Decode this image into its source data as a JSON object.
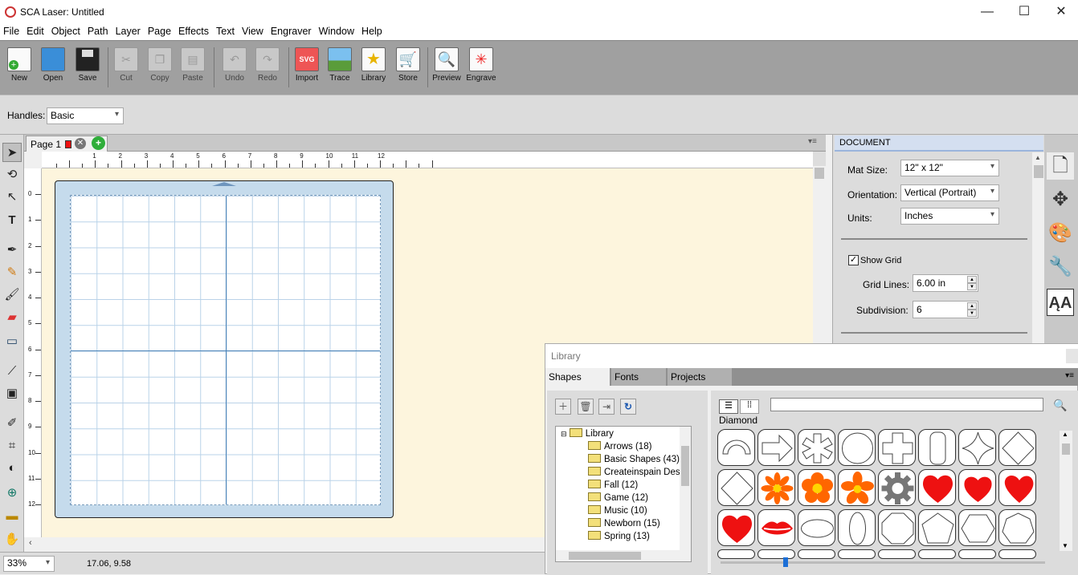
{
  "window": {
    "title": "SCA Laser: Untitled",
    "minimize": "—",
    "maximize": "☐",
    "close": "✕"
  },
  "menu": [
    "File",
    "Edit",
    "Object",
    "Path",
    "Layer",
    "Page",
    "Effects",
    "Text",
    "View",
    "Engraver",
    "Window",
    "Help"
  ],
  "toolbar": {
    "new": "New",
    "open": "Open",
    "save": "Save",
    "cut": "Cut",
    "copy": "Copy",
    "paste": "Paste",
    "undo": "Undo",
    "redo": "Redo",
    "import": "Import",
    "trace": "Trace",
    "library": "Library",
    "store": "Store",
    "preview": "Preview",
    "engrave": "Engrave"
  },
  "handles": {
    "label": "Handles:",
    "value": "Basic"
  },
  "page_tab": {
    "label": "Page 1"
  },
  "ruler": {
    "h": [
      "1",
      "2",
      "3",
      "4",
      "5",
      "6",
      "7",
      "8",
      "9",
      "10",
      "11",
      "12"
    ],
    "v": [
      "0",
      "1",
      "2",
      "3",
      "4",
      "5",
      "6",
      "7",
      "8",
      "9",
      "10",
      "11",
      "12"
    ]
  },
  "status": {
    "zoom": "33%",
    "coords": "17.06, 9.58"
  },
  "document": {
    "header": "DOCUMENT",
    "mat_label": "Mat Size:",
    "mat_value": "12\" x 12\"",
    "orient_label": "Orientation:",
    "orient_value": "Vertical (Portrait)",
    "units_label": "Units:",
    "units_value": "Inches",
    "show_grid": "Show Grid",
    "show_grid_checked": true,
    "grid_lines_label": "Grid Lines:",
    "grid_lines_value": "6.00 in",
    "subdivision_label": "Subdivision:",
    "subdivision_value": "6"
  },
  "library": {
    "title": "Library",
    "tabs": [
      "Shapes",
      "Fonts",
      "Projects"
    ],
    "search_value": "",
    "selected_shape": "Diamond",
    "tree": [
      "Library",
      "Arrows (18)",
      "Basic Shapes (43)",
      "Createinspain Desi",
      "Fall (12)",
      "Game (12)",
      "Music (10)",
      "Newborn (15)",
      "Spring (13)"
    ],
    "slider_value": 0.2
  },
  "colors": {
    "toolbar": "#a0a0a0",
    "canvas": "#fdf5dd",
    "mat": "#c5dbec",
    "grid_line": "#b9d2e8",
    "accent_red": "#ee1111",
    "flower": "#ff6600"
  }
}
